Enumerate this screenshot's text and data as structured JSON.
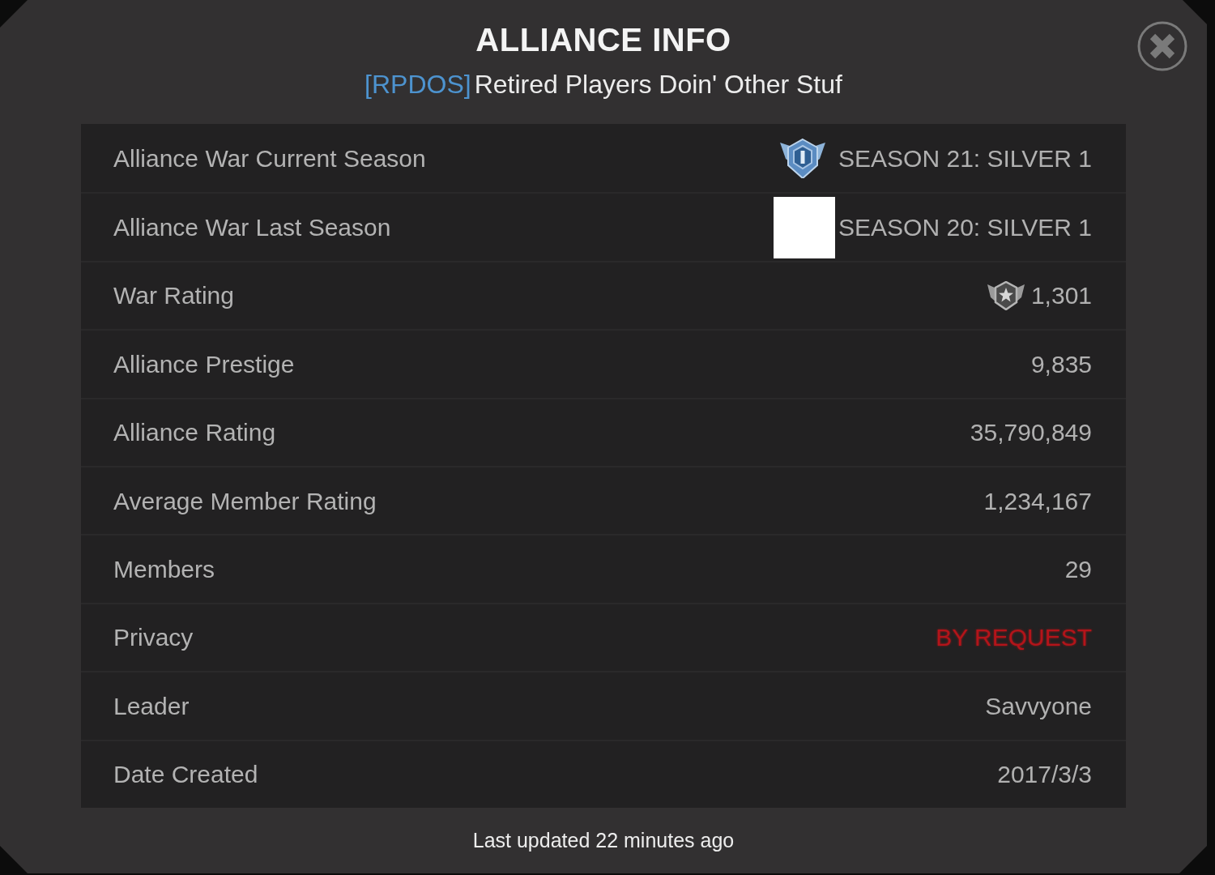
{
  "title": "ALLIANCE INFO",
  "alliance": {
    "tag": "[RPDOS]",
    "name": "Retired Players Doin' Other Stuf"
  },
  "rows": [
    {
      "label": "Alliance War Current Season",
      "value": "SEASON 21: SILVER 1",
      "kind": "shield"
    },
    {
      "label": "Alliance War Last Season",
      "value": "SEASON 20: SILVER 1",
      "kind": "blank"
    },
    {
      "label": "War Rating",
      "value": "1,301",
      "kind": "medal"
    },
    {
      "label": "Alliance Prestige",
      "value": "9,835",
      "kind": "plain"
    },
    {
      "label": "Alliance Rating",
      "value": "35,790,849",
      "kind": "plain"
    },
    {
      "label": "Average Member Rating",
      "value": "1,234,167",
      "kind": "plain"
    },
    {
      "label": "Members",
      "value": "29",
      "kind": "plain"
    },
    {
      "label": "Privacy",
      "value": "BY REQUEST",
      "kind": "alert"
    },
    {
      "label": "Leader",
      "value": "Savvyone",
      "kind": "plain"
    },
    {
      "label": "Date Created",
      "value": "2017/3/3",
      "kind": "plain"
    }
  ],
  "footer": "Last updated 22 minutes ago"
}
